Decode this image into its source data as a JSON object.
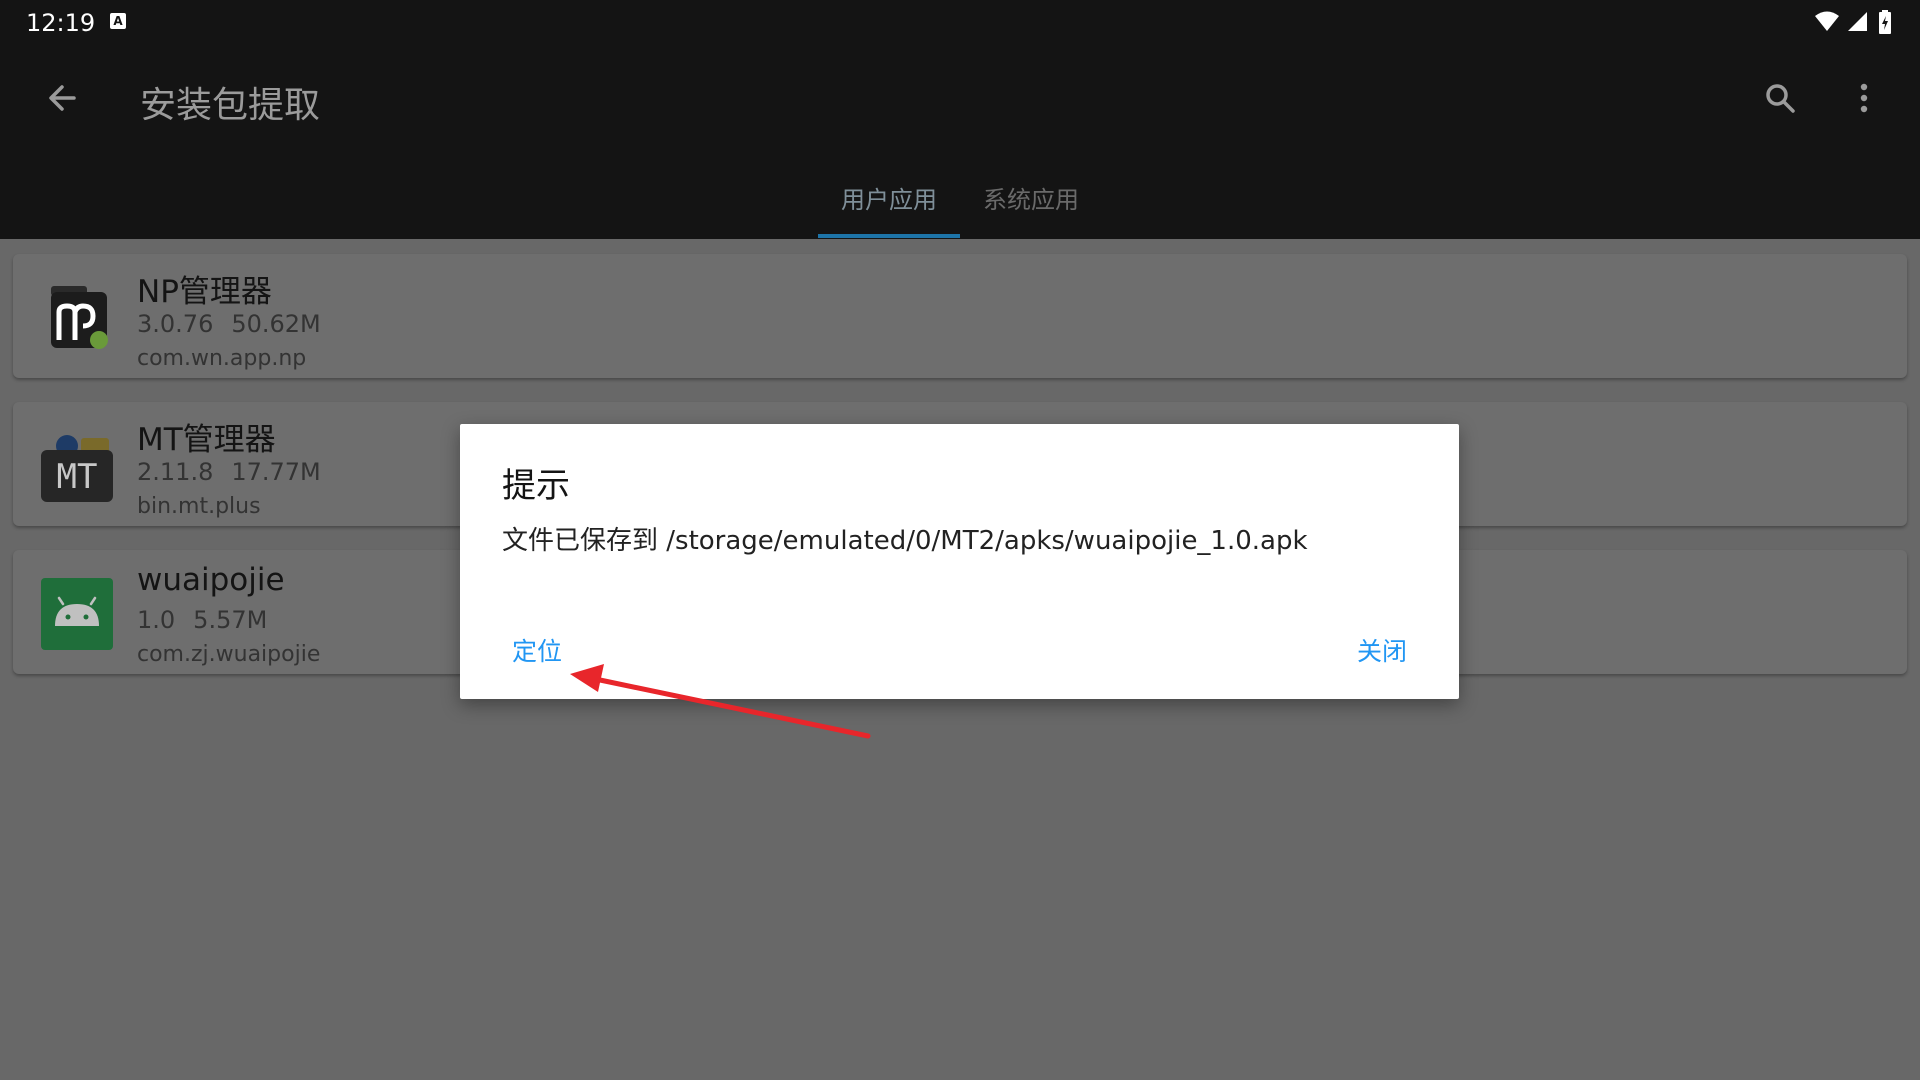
{
  "status_bar": {
    "time": "12:19",
    "notification_icon": "a-badge-icon",
    "badge_letter": "A",
    "icons": [
      "wifi-icon",
      "signal-icon",
      "battery-charging-icon"
    ]
  },
  "app_bar": {
    "title": "安装包提取",
    "back_icon": "arrow-back-icon",
    "search_icon": "search-icon",
    "more_icon": "more-vert-icon"
  },
  "tabs": [
    {
      "label": "用户应用",
      "selected": true
    },
    {
      "label": "系统应用",
      "selected": false
    }
  ],
  "apps": [
    {
      "name": "NP管理器",
      "version": "3.0.76",
      "size": "50.62M",
      "package": "com.wn.app.np",
      "icon": "np-manager-app-icon"
    },
    {
      "name": "MT管理器",
      "version": "2.11.8",
      "size": "17.77M",
      "package": "bin.mt.plus",
      "icon": "mt-manager-app-icon",
      "icon_text": "MT"
    },
    {
      "name": "wuaipojie",
      "version": "1.0",
      "size": "5.57M",
      "package": "com.zj.wuaipojie",
      "icon": "android-app-icon"
    }
  ],
  "dialog": {
    "title": "提示",
    "message": "文件已保存到 /storage/emulated/0/MT2/apks/wuaipojie_1.0.apk",
    "locate_button": "定位",
    "close_button": "关闭"
  },
  "colors": {
    "accent": "#2196f3",
    "annotation_arrow": "#e8262b",
    "bar": "#141414",
    "scrim_background": "#686868"
  }
}
